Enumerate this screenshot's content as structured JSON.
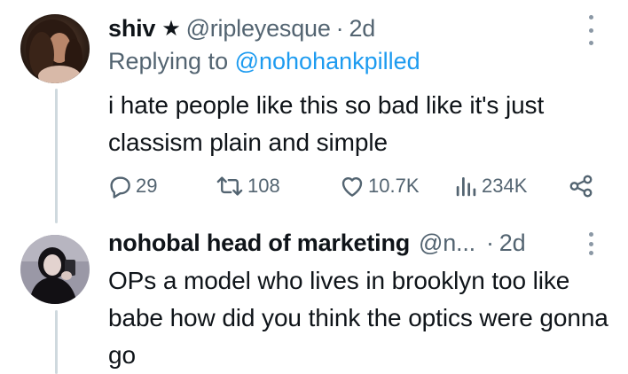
{
  "tweets": [
    {
      "display_name": "shiv",
      "badge": "★",
      "handle": "@ripleyesque",
      "separator": "·",
      "time": "2d",
      "replying_prefix": "Replying to ",
      "replying_to": "@nohohankpilled",
      "text": "i hate people like this so bad like it's just classism plain and simple",
      "stats": {
        "replies": "29",
        "retweets": "108",
        "likes": "10.7K",
        "views": "234K"
      }
    },
    {
      "display_name": "nohobal head of marketing",
      "handle": "@n...",
      "separator": "·",
      "time": "2d",
      "text": "OPs a model who lives in brooklyn too like babe how did you think the optics were gonna go"
    }
  ],
  "icons": {
    "reply": "reply-icon",
    "retweet": "retweet-icon",
    "like": "heart-icon",
    "views": "views-icon",
    "share": "share-icon",
    "more": "more-icon"
  },
  "colors": {
    "text": "#0f1419",
    "secondary": "#536471",
    "link": "#1d9bf0",
    "thread_line": "#cfd9de"
  }
}
